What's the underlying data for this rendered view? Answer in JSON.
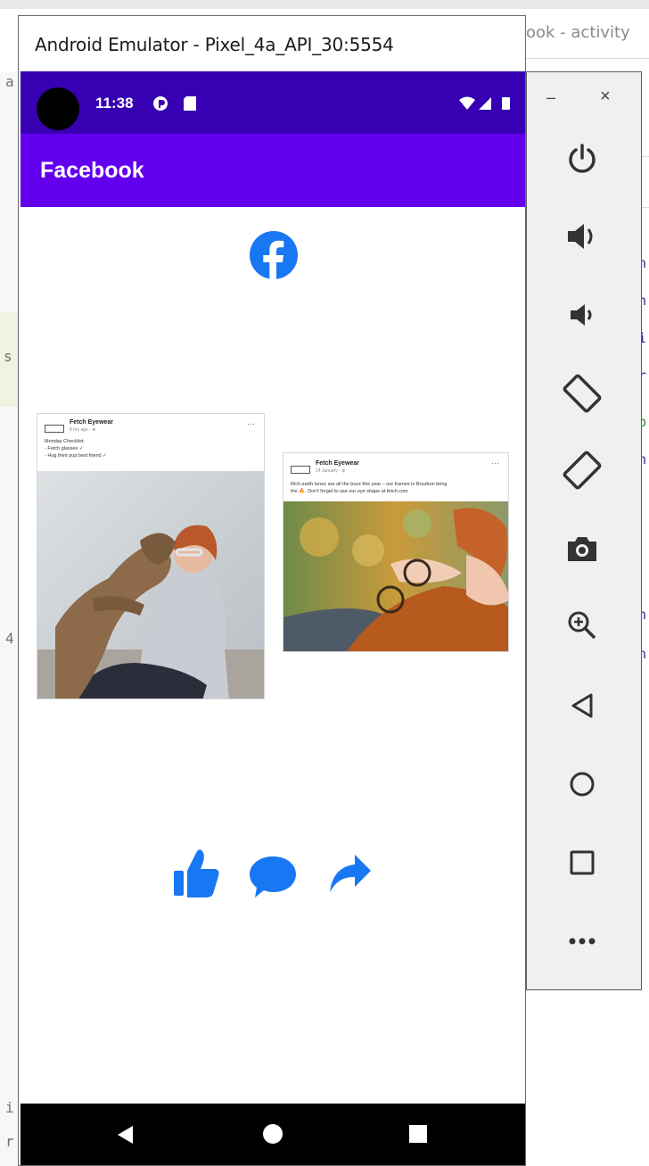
{
  "background": {
    "tab_title": "ook - activity",
    "left_fragments": [
      "a",
      "s",
      "4",
      "i",
      "r"
    ],
    "right_fragments": [
      "h",
      "h",
      "i",
      "r",
      "b",
      "h",
      "h",
      "h"
    ]
  },
  "emulator": {
    "window_title": "Android Emulator - Pixel_4a_API_30:5554"
  },
  "status_bar": {
    "time": "11:38"
  },
  "app_bar": {
    "title": "Facebook",
    "color": "#6200ee",
    "status_color": "#3700b3"
  },
  "posts": [
    {
      "page_name": "Fetch Eyewear",
      "subtitle": "8 hrs ago · ⊕",
      "lines": [
        "Monday Checklist:",
        "- Fetch glasses ✓",
        "- Hug their pup best friend ✓"
      ]
    },
    {
      "page_name": "Fetch Eyewear",
      "subtitle": "14 January · ⊕",
      "lines": [
        "Rich earth tones are all the buzz this year – our frames in Bourbon bring",
        "the 🔥. Don't forget to use our eye shape at fetch.com"
      ]
    }
  ],
  "actions": {
    "accent": "#1877f2",
    "icons": [
      "like-icon",
      "comment-icon",
      "share-icon"
    ]
  },
  "toolbar": {
    "minimize": "–",
    "close": "×",
    "items": [
      "power",
      "volume-up",
      "volume-down",
      "rotate-left",
      "rotate-right",
      "screenshot",
      "zoom",
      "back",
      "home",
      "overview",
      "more"
    ]
  }
}
